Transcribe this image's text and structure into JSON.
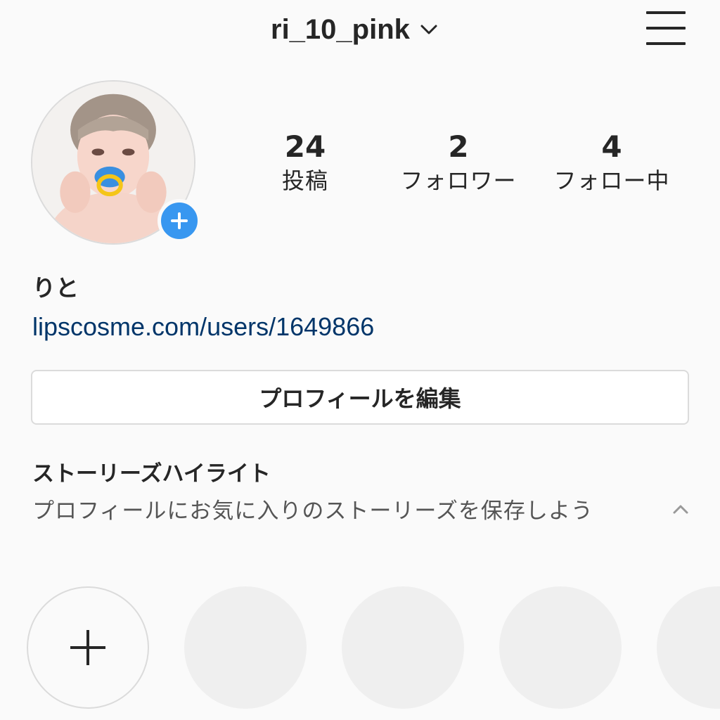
{
  "header": {
    "username": "ri_10_pink"
  },
  "profile": {
    "display_name": "りと",
    "website": "lipscosme.com/users/1649866"
  },
  "stats": {
    "posts": {
      "count": "24",
      "label": "投稿"
    },
    "followers": {
      "count": "2",
      "label": "フォロワー"
    },
    "following": {
      "count": "4",
      "label": "フォロー中"
    }
  },
  "actions": {
    "edit_profile_label": "プロフィールを編集"
  },
  "highlights": {
    "title": "ストーリーズハイライト",
    "description": "プロフィールにお気に入りのストーリーズを保存しよう"
  },
  "colors": {
    "accent_blue": "#3897f0",
    "link": "#003569",
    "text": "#262626",
    "border": "#dbdbdb",
    "background": "#fafafa"
  },
  "icons": {
    "username_dropdown": "chevron-down-icon",
    "menu": "hamburger-menu-icon",
    "add_story": "plus-circle-icon",
    "collapse": "chevron-up-icon",
    "new_highlight": "plus-icon"
  }
}
